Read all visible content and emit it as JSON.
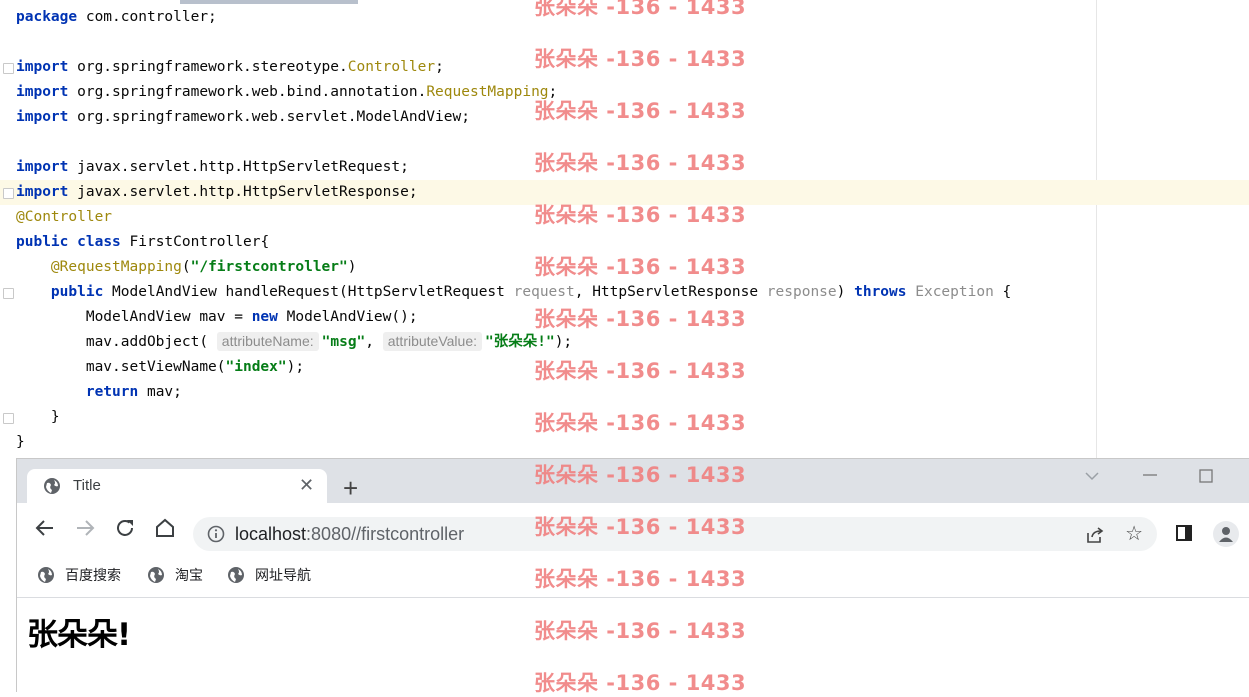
{
  "editor": {
    "lines": [
      {
        "parts": [
          {
            "t": "package",
            "c": "kw"
          },
          {
            "t": " com.controller;"
          }
        ]
      },
      {
        "parts": []
      },
      {
        "fold": true,
        "parts": [
          {
            "t": "import",
            "c": "kw"
          },
          {
            "t": " org.springframework.stereotype."
          },
          {
            "t": "Controller",
            "c": "cls"
          },
          {
            "t": ";"
          }
        ]
      },
      {
        "parts": [
          {
            "t": "import",
            "c": "kw"
          },
          {
            "t": " org.springframework.web.bind.annotation."
          },
          {
            "t": "RequestMapping",
            "c": "cls"
          },
          {
            "t": ";"
          }
        ]
      },
      {
        "parts": [
          {
            "t": "import",
            "c": "kw"
          },
          {
            "t": " org.springframework.web.servlet.ModelAndView;"
          }
        ]
      },
      {
        "parts": []
      },
      {
        "parts": [
          {
            "t": "import",
            "c": "kw"
          },
          {
            "t": " javax.servlet.http.HttpServletRequest;"
          }
        ]
      },
      {
        "current": true,
        "fold": true,
        "parts": [
          {
            "t": "import",
            "c": "kw"
          },
          {
            "t": " javax.servlet.http.HttpServletResponse;"
          }
        ]
      },
      {
        "parts": [
          {
            "t": "@Controller",
            "c": "ann"
          }
        ]
      },
      {
        "parts": [
          {
            "t": "public",
            "c": "kw"
          },
          {
            "t": " "
          },
          {
            "t": "class",
            "c": "kw"
          },
          {
            "t": " FirstController{"
          }
        ]
      },
      {
        "parts": [
          {
            "t": "    "
          },
          {
            "t": "@RequestMapping",
            "c": "ann"
          },
          {
            "t": "("
          },
          {
            "t": "\"/firstcontroller\"",
            "c": "str"
          },
          {
            "t": ")"
          }
        ]
      },
      {
        "fold": true,
        "parts": [
          {
            "t": "    "
          },
          {
            "t": "public",
            "c": "kw"
          },
          {
            "t": " ModelAndView handleRequest(HttpServletRequest "
          },
          {
            "t": "request",
            "c": "param"
          },
          {
            "t": ", HttpServletResponse "
          },
          {
            "t": "response",
            "c": "param"
          },
          {
            "t": ") "
          },
          {
            "t": "throws",
            "c": "kw"
          },
          {
            "t": " "
          },
          {
            "t": "Exception",
            "c": "param"
          },
          {
            "t": " {"
          }
        ]
      },
      {
        "parts": [
          {
            "t": "        ModelAndView mav = "
          },
          {
            "t": "new",
            "c": "kw"
          },
          {
            "t": " ModelAndView();"
          }
        ]
      },
      {
        "parts": [
          {
            "t": "        mav.addObject( "
          },
          {
            "t": "attributeName:",
            "c": "hint"
          },
          {
            "t": "\"msg\"",
            "c": "str"
          },
          {
            "t": ", "
          },
          {
            "t": "attributeValue:",
            "c": "hint"
          },
          {
            "t": "\"张朵朵!\"",
            "c": "str"
          },
          {
            "t": ");"
          }
        ]
      },
      {
        "parts": [
          {
            "t": "        mav.setViewName("
          },
          {
            "t": "\"index\"",
            "c": "str"
          },
          {
            "t": ");"
          }
        ]
      },
      {
        "parts": [
          {
            "t": "        "
          },
          {
            "t": "return",
            "c": "kw"
          },
          {
            "t": " mav;"
          }
        ]
      },
      {
        "fold": true,
        "parts": [
          {
            "t": "    }"
          }
        ]
      },
      {
        "parts": [
          {
            "t": "}"
          }
        ]
      }
    ]
  },
  "browser": {
    "tab_title": "Title",
    "tab_close": "✕",
    "new_tab": "+",
    "url_host": "localhost",
    "url_rest": ":8080//firstcontroller",
    "bookmarks": [
      {
        "label": "百度搜索"
      },
      {
        "label": "淘宝"
      },
      {
        "label": "网址导航"
      }
    ],
    "page_heading": "张朵朵!"
  },
  "watermark": {
    "text": "张朵朵 -136 - 1433",
    "color": "#f08080"
  }
}
